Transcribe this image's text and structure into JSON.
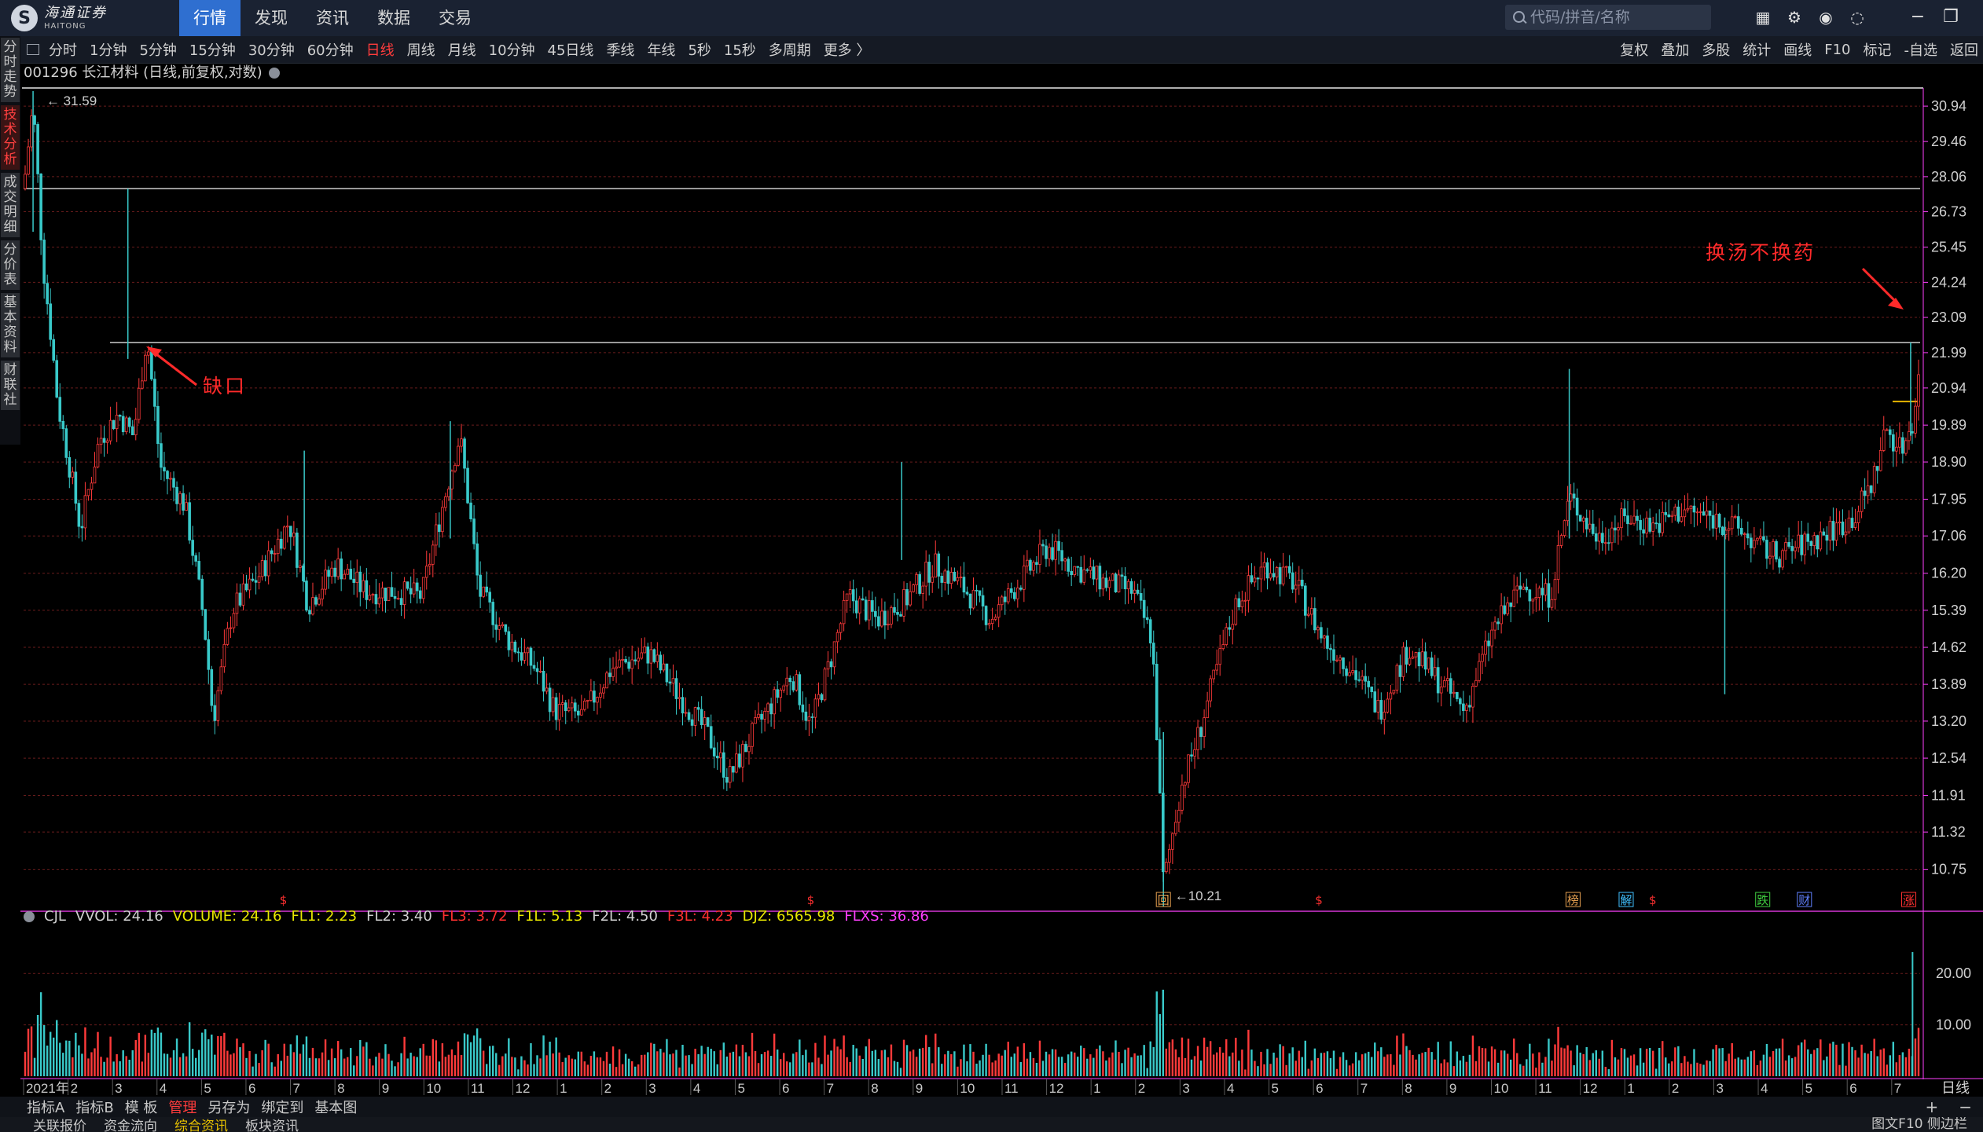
{
  "app": {
    "logo_cn": "海通证券",
    "logo_en": "HAITONG",
    "logo_glyph": "S",
    "nav_tabs": [
      "行情",
      "发现",
      "资讯",
      "数据",
      "交易"
    ],
    "active_nav": 0,
    "search_placeholder": "代码/拼音/名称",
    "top_icons": [
      "grid-icon",
      "settings-icon",
      "skin-icon",
      "chat-icon"
    ],
    "window_controls": [
      "minimize-icon",
      "restore-icon"
    ]
  },
  "periods": {
    "items": [
      "分时",
      "1分钟",
      "5分钟",
      "15分钟",
      "30分钟",
      "60分钟",
      "日线",
      "周线",
      "月线",
      "10分钟",
      "45日线",
      "季线",
      "年线",
      "5秒",
      "15秒",
      "多周期",
      "更多 〉"
    ],
    "active_index": 6
  },
  "tools": [
    "复权",
    "叠加",
    "多股",
    "统计",
    "画线",
    "F10",
    "标记",
    "-自选",
    "返回"
  ],
  "side_tabs": [
    "分时走势",
    "技术分析",
    "成交明细",
    "分价表",
    "基本资料",
    "财联社"
  ],
  "active_side_tab": 1,
  "chart_title": "001296 长江材料 (日线,前复权,对数)",
  "annotations": {
    "gap_label": "缺口",
    "right_label": "换汤不换药"
  },
  "volume_legend": [
    {
      "label": "CJL",
      "color": "#d0d0d0"
    },
    {
      "label": "VVOL: 24.16",
      "color": "#d0d0d0"
    },
    {
      "label": "VOLUME: 24.16",
      "color": "#e8e800"
    },
    {
      "label": "FL1: 2.23",
      "color": "#e8e800"
    },
    {
      "label": "FL2: 3.40",
      "color": "#d0d0d0"
    },
    {
      "label": "FL3: 3.72",
      "color": "#ff3030"
    },
    {
      "label": "F1L: 5.13",
      "color": "#e8e800"
    },
    {
      "label": "F2L: 4.50",
      "color": "#d0d0d0"
    },
    {
      "label": "F3L: 4.23",
      "color": "#ff3030"
    },
    {
      "label": "DJZ: 6565.98",
      "color": "#e8e800"
    },
    {
      "label": "FLXS: 36.86",
      "color": "#ff40ff"
    }
  ],
  "bottom_tabs": [
    "指标A",
    "指标B",
    "模 板",
    "管理",
    "另存为",
    "绑定到",
    "基本图"
  ],
  "bottom_tab_active": 3,
  "zoom_controls": [
    "+",
    "−"
  ],
  "status_bar": [
    "关联报价",
    "资金流向",
    "综合资讯",
    "板块资讯"
  ],
  "status_right": "图文F10 侧边栏",
  "period_label": "日线",
  "chart_data": [
    {
      "type": "candlestick",
      "title": "001296 长江材料 (日线,前复权,对数)",
      "scale": "log",
      "ylim": [
        10.21,
        31.59
      ],
      "y_ticks": [
        "30.94",
        "29.46",
        "28.06",
        "26.73",
        "25.45",
        "24.24",
        "23.09",
        "21.99",
        "20.94",
        "19.89",
        "18.90",
        "17.95",
        "17.06",
        "16.20",
        "15.39",
        "14.62",
        "13.89",
        "13.20",
        "12.54",
        "11.91",
        "11.32",
        "10.75"
      ],
      "max_label": "31.59",
      "min_label": "10.21",
      "reference_lines": [
        27.6,
        22.3
      ],
      "x_start": "2021年",
      "x_ticks": [
        "2021年",
        "2",
        "3",
        "4",
        "5",
        "6",
        "7",
        "8",
        "9",
        "10",
        "11",
        "12",
        "1",
        "2",
        "3",
        "4",
        "5",
        "6",
        "7",
        "8",
        "9",
        "10",
        "11",
        "12",
        "1",
        "2",
        "3",
        "4",
        "5",
        "6",
        "7",
        "8",
        "9",
        "10",
        "11",
        "12",
        "1",
        "2",
        "3",
        "4",
        "5",
        "6",
        "7"
      ],
      "event_markers": [
        {
          "label": "$",
          "color": "#ff3030",
          "x_frac": 0.137
        },
        {
          "label": "$",
          "color": "#ff3030",
          "x_frac": 0.415
        },
        {
          "label": "回",
          "color": "#e6a050",
          "x_frac": 0.601
        },
        {
          "label": "$",
          "color": "#ff3030",
          "x_frac": 0.683
        },
        {
          "label": "榜",
          "color": "#e6a050",
          "x_frac": 0.817
        },
        {
          "label": "解",
          "color": "#40c0ff",
          "x_frac": 0.845
        },
        {
          "label": "$",
          "color": "#ff3030",
          "x_frac": 0.859
        },
        {
          "label": "跌",
          "color": "#40d040",
          "x_frac": 0.917
        },
        {
          "label": "财",
          "color": "#6080ff",
          "x_frac": 0.939
        },
        {
          "label": "涨",
          "color": "#ff3030",
          "x_frac": 0.994
        }
      ],
      "path_anchors": [
        [
          0.0,
          27.6
        ],
        [
          0.005,
          31.0
        ],
        [
          0.01,
          25.0
        ],
        [
          0.018,
          20.5
        ],
        [
          0.03,
          17.2
        ],
        [
          0.04,
          19.5
        ],
        [
          0.05,
          20.2
        ],
        [
          0.058,
          19.6
        ],
        [
          0.065,
          22.5
        ],
        [
          0.072,
          18.8
        ],
        [
          0.085,
          17.8
        ],
        [
          0.095,
          15.2
        ],
        [
          0.1,
          13.2
        ],
        [
          0.11,
          15.4
        ],
        [
          0.125,
          16.2
        ],
        [
          0.14,
          17.4
        ],
        [
          0.15,
          15.5
        ],
        [
          0.165,
          16.4
        ],
        [
          0.18,
          15.8
        ],
        [
          0.195,
          15.8
        ],
        [
          0.21,
          15.7
        ],
        [
          0.22,
          17.6
        ],
        [
          0.23,
          19.6
        ],
        [
          0.24,
          15.8
        ],
        [
          0.255,
          14.8
        ],
        [
          0.27,
          14.2
        ],
        [
          0.28,
          13.4
        ],
        [
          0.295,
          13.3
        ],
        [
          0.31,
          14.2
        ],
        [
          0.33,
          14.5
        ],
        [
          0.345,
          13.7
        ],
        [
          0.36,
          13.0
        ],
        [
          0.372,
          12.2
        ],
        [
          0.385,
          13.0
        ],
        [
          0.405,
          14.1
        ],
        [
          0.415,
          13.1
        ],
        [
          0.425,
          14.3
        ],
        [
          0.435,
          15.7
        ],
        [
          0.45,
          15.2
        ],
        [
          0.465,
          15.6
        ],
        [
          0.48,
          16.4
        ],
        [
          0.495,
          15.9
        ],
        [
          0.51,
          15.2
        ],
        [
          0.525,
          16.0
        ],
        [
          0.54,
          16.8
        ],
        [
          0.555,
          16.3
        ],
        [
          0.57,
          16.0
        ],
        [
          0.585,
          15.8
        ],
        [
          0.595,
          14.8
        ],
        [
          0.601,
          10.5
        ],
        [
          0.61,
          12.0
        ],
        [
          0.62,
          13.0
        ],
        [
          0.63,
          14.3
        ],
        [
          0.64,
          15.6
        ],
        [
          0.655,
          16.4
        ],
        [
          0.67,
          16.0
        ],
        [
          0.685,
          14.8
        ],
        [
          0.7,
          14.2
        ],
        [
          0.715,
          13.4
        ],
        [
          0.73,
          14.6
        ],
        [
          0.745,
          14.0
        ],
        [
          0.76,
          13.4
        ],
        [
          0.775,
          15.0
        ],
        [
          0.79,
          15.9
        ],
        [
          0.805,
          15.7
        ],
        [
          0.815,
          18.0
        ],
        [
          0.83,
          17.0
        ],
        [
          0.845,
          17.5
        ],
        [
          0.86,
          17.3
        ],
        [
          0.875,
          17.7
        ],
        [
          0.89,
          17.5
        ],
        [
          0.905,
          17.2
        ],
        [
          0.915,
          16.8
        ],
        [
          0.925,
          16.6
        ],
        [
          0.935,
          16.8
        ],
        [
          0.95,
          17.1
        ],
        [
          0.965,
          17.5
        ],
        [
          0.975,
          18.4
        ],
        [
          0.982,
          19.8
        ],
        [
          0.99,
          19.2
        ],
        [
          0.996,
          20.0
        ],
        [
          1.0,
          21.5
        ]
      ]
    },
    {
      "type": "bar",
      "title": "CJL",
      "ylim": [
        0,
        26
      ],
      "y_ticks": [
        "20.00",
        "10.00"
      ],
      "last_value": 24.16
    }
  ]
}
